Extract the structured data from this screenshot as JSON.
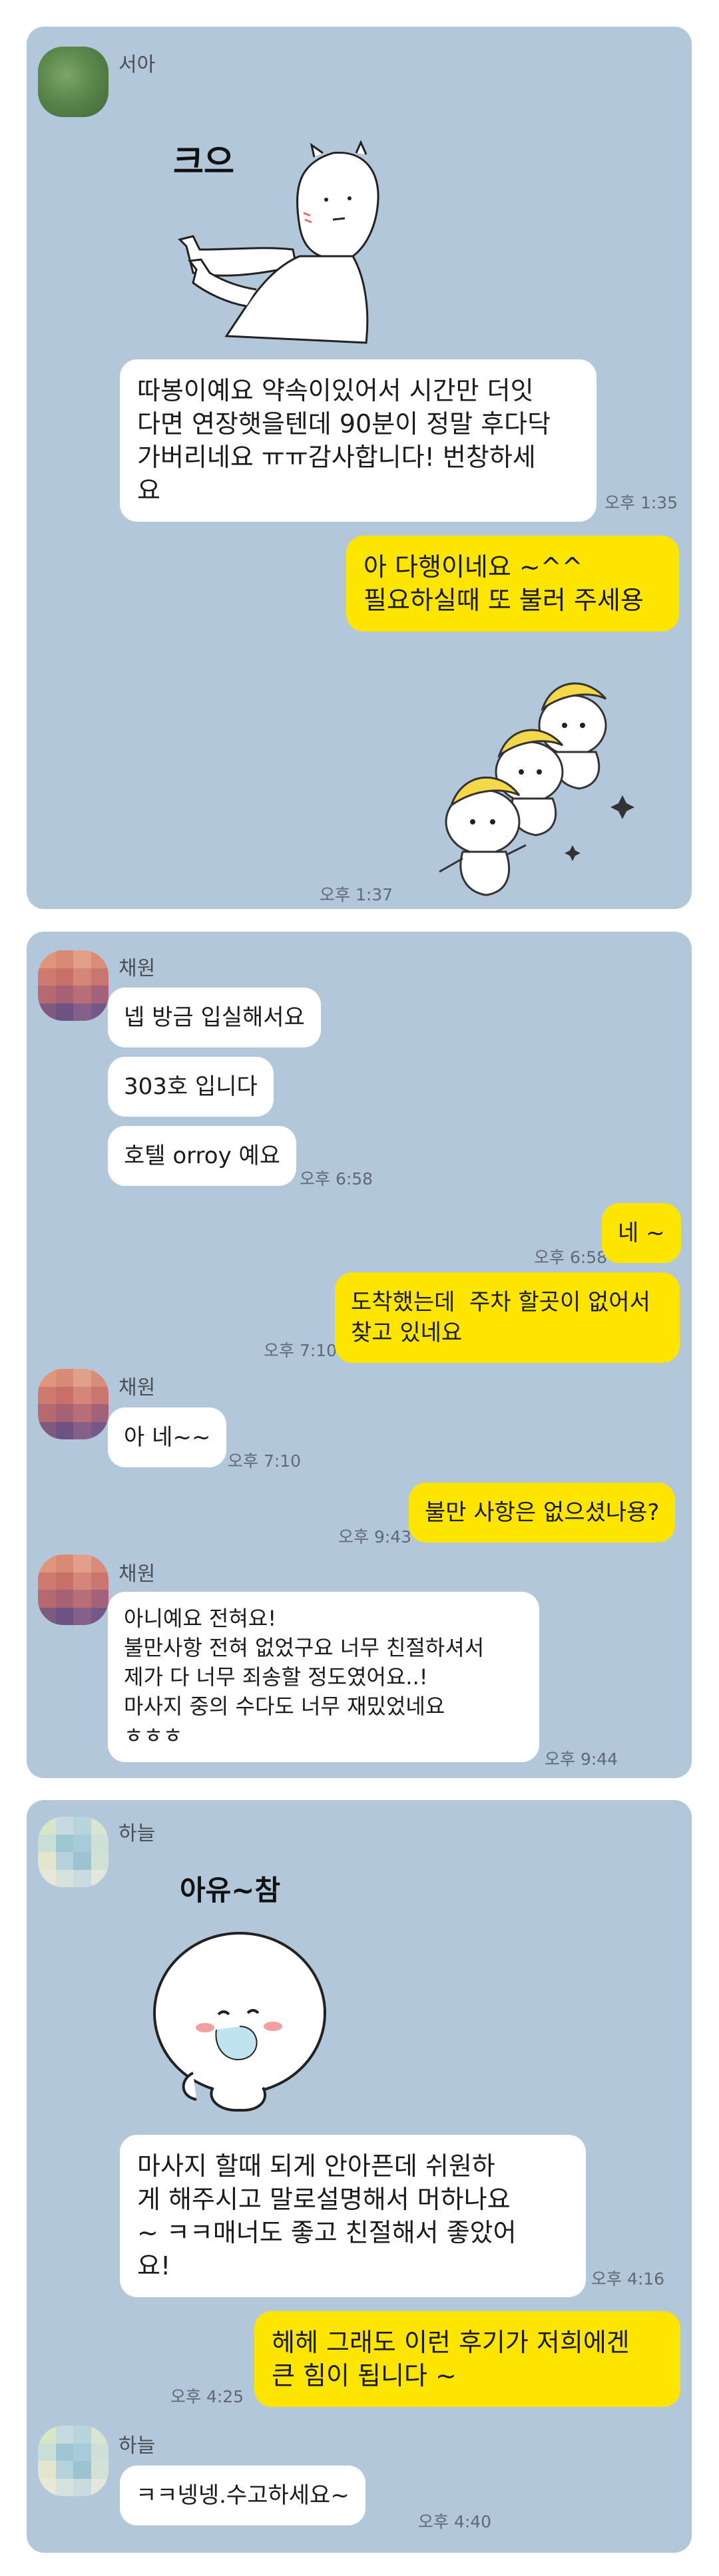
{
  "colors": {
    "card_bg": "#b2c7da",
    "my_bubble": "#fee500",
    "their_bubble": "#ffffff"
  },
  "cards": [
    {
      "sender": "서아",
      "sticker_text": "크으",
      "msg1": "따봉이예요 약속이있어서 시간만 더잇\n다면 연장햇을텐데 90분이 정말 후다닥\n가버리네요 ㅠㅠ감사합니다! 번창하세\n요",
      "msg1_time": "오후 1:35",
      "reply": "아 다행이네요 ~^^\n필요하실때 또 불러 주세용",
      "reply_time": "오후 1:37"
    },
    {
      "sender": "채원",
      "messages": [
        "넵 방금 입실해서요",
        "303호 입니다",
        "호텔 orroy 예요"
      ],
      "msg_time": "오후 6:58",
      "reply1": "네 ~",
      "reply1_time": "오후 6:58",
      "reply2": "도착했는데  주차 할곳이 없어서\n찾고 있네요",
      "reply2_time": "오후 7:10",
      "msg2": "아 네~~",
      "msg2_time": "오후 7:10",
      "reply3": "불만 사항은 없으셨나용?",
      "reply3_time": "오후 9:43",
      "msg3": "아니예요 전혀요!\n불만사항 전혀 없었구요 너무 친절하셔서\n제가 다 너무 죄송할 정도였어요..!\n마사지 중의 수다도 너무 재밌었네요\nㅎㅎㅎ",
      "msg3_time": "오후 9:44"
    },
    {
      "sender": "하늘",
      "sticker_text": "아유~참",
      "msg1": "마사지 할때 되게 안아픈데 쉬원하\n게 해주시고 말로설명해서 머하나요\n~ ㅋㅋ매너도 좋고 친절해서 좋았어\n요!",
      "msg1_time": "오후 4:16",
      "reply": "헤헤 그래도 이런 후기가 저희에겐\n큰 힘이 됩니다 ~",
      "reply_time": "오후 4:25",
      "msg2": "ㅋㅋ넹넹.수고하세요~",
      "msg2_time": "오후 4:40"
    }
  ]
}
